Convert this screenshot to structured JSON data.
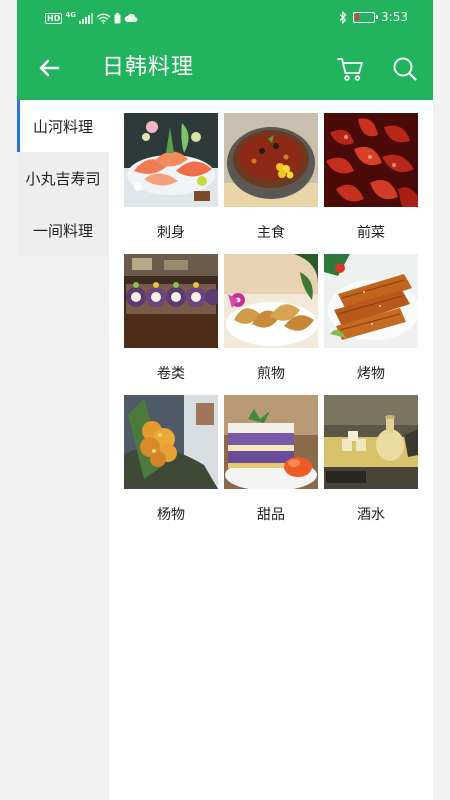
{
  "status": {
    "time": "3:53",
    "badges": [
      "HD",
      "4G"
    ],
    "icons": [
      "signal-icon",
      "wifi-icon",
      "battery-saver-icon",
      "cloud-icon",
      "bluetooth-icon",
      "battery-icon"
    ]
  },
  "appbar": {
    "title": "日韩料理",
    "back_icon": "arrow-left-icon",
    "cart_icon": "cart-icon",
    "search_icon": "search-icon",
    "color": "#22b35e"
  },
  "sidebar": {
    "items": [
      {
        "label": "山河料理"
      },
      {
        "label": "小丸吉寿司"
      },
      {
        "label": "一间料理"
      }
    ],
    "active_color": "#2a73d8"
  },
  "categories": [
    {
      "label": "刺身"
    },
    {
      "label": "主食"
    },
    {
      "label": "前菜"
    },
    {
      "label": "卷类"
    },
    {
      "label": "煎物"
    },
    {
      "label": "烤物"
    },
    {
      "label": "杨物"
    },
    {
      "label": "甜品"
    },
    {
      "label": "酒水"
    }
  ]
}
